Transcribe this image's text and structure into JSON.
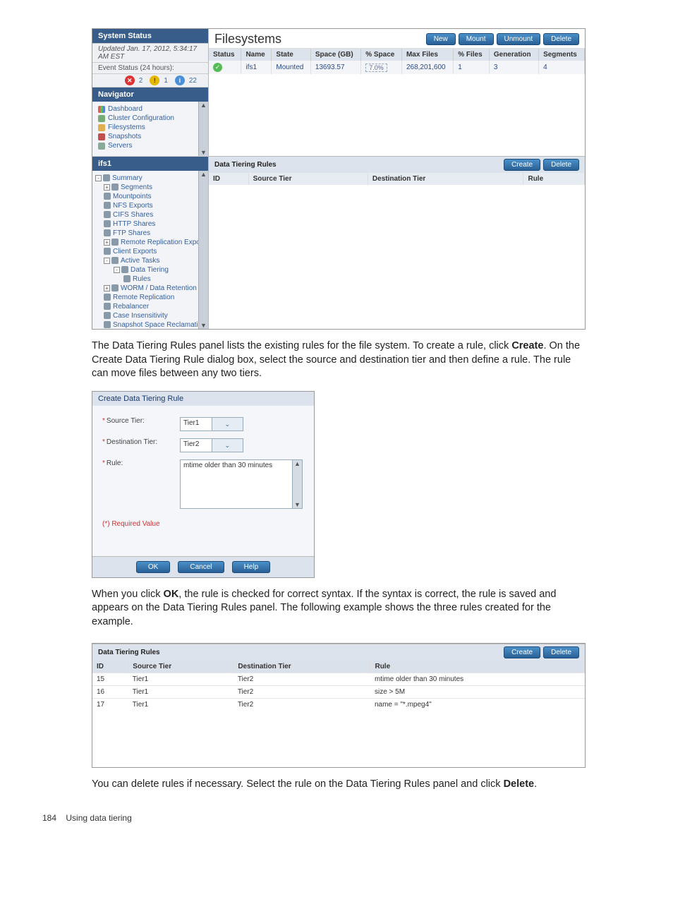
{
  "system_status": {
    "title": "System Status",
    "updated": "Updated Jan. 17, 2012, 5:34:17 AM EST",
    "event_label": "Event Status (24 hours):",
    "red": "2",
    "yellow": "1",
    "blue": "22"
  },
  "navigator": {
    "title": "Navigator",
    "items": [
      "Dashboard",
      "Cluster Configuration",
      "Filesystems",
      "Snapshots",
      "Servers"
    ]
  },
  "ifs": {
    "title": "ifs1",
    "tree": [
      {
        "lvl": 0,
        "label": "Summary",
        "exp": "-"
      },
      {
        "lvl": 1,
        "label": "Segments",
        "exp": "+"
      },
      {
        "lvl": 1,
        "label": "Mountpoints",
        "exp": ""
      },
      {
        "lvl": 1,
        "label": "NFS Exports",
        "exp": ""
      },
      {
        "lvl": 1,
        "label": "CIFS Shares",
        "exp": ""
      },
      {
        "lvl": 1,
        "label": "HTTP Shares",
        "exp": ""
      },
      {
        "lvl": 1,
        "label": "FTP Shares",
        "exp": ""
      },
      {
        "lvl": 1,
        "label": "Remote Replication Exports",
        "exp": "+"
      },
      {
        "lvl": 1,
        "label": "Client Exports",
        "exp": ""
      },
      {
        "lvl": 1,
        "label": "Active Tasks",
        "exp": "-"
      },
      {
        "lvl": 2,
        "label": "Data Tiering",
        "exp": "-"
      },
      {
        "lvl": 3,
        "label": "Rules",
        "exp": ""
      },
      {
        "lvl": 1,
        "label": "WORM / Data Retention",
        "exp": "+"
      },
      {
        "lvl": 1,
        "label": "Remote Replication",
        "exp": ""
      },
      {
        "lvl": 1,
        "label": "Rebalancer",
        "exp": ""
      },
      {
        "lvl": 1,
        "label": "Case Insensitivity",
        "exp": ""
      },
      {
        "lvl": 1,
        "label": "Snapshot Space Reclamation",
        "exp": ""
      }
    ]
  },
  "filesystems": {
    "title": "Filesystems",
    "buttons": {
      "new": "New",
      "mount": "Mount",
      "unmount": "Unmount",
      "delete": "Delete"
    },
    "headers": [
      "Status",
      "Name",
      "State",
      "Space (GB)",
      "% Space",
      "Max Files",
      "% Files",
      "Generation",
      "Segments"
    ],
    "row": {
      "name": "ifs1",
      "state": "Mounted",
      "space": "13693.57",
      "pct": "7.0%",
      "maxfiles": "268,201,600",
      "pctfiles": "1",
      "gen": "3",
      "seg": "4"
    }
  },
  "dtr1": {
    "title": "Data Tiering Rules",
    "create": "Create",
    "delete": "Delete",
    "headers": [
      "ID",
      "Source Tier",
      "Destination Tier",
      "Rule"
    ]
  },
  "para1_a": "The Data Tiering Rules panel lists the existing rules for the file system. To create a rule, click ",
  "para1_b": "Create",
  "para1_c": ". On the Create Data Tiering Rule dialog box, select the source and destination tier and then define a rule. The rule can move files between any two tiers.",
  "dialog": {
    "title": "Create Data Tiering Rule",
    "source_label": "Source Tier:",
    "source_value": "Tier1",
    "dest_label": "Destination Tier:",
    "dest_value": "Tier2",
    "rule_label": "Rule:",
    "rule_value": "mtime older than 30 minutes",
    "req_note": "(*) Required Value",
    "ok": "OK",
    "cancel": "Cancel",
    "help": "Help"
  },
  "para2_a": "When you click ",
  "para2_b": "OK",
  "para2_c": ", the rule is checked for correct syntax. If the syntax is correct, the rule is saved and appears on the Data Tiering Rules panel. The following example shows the three rules created for the example.",
  "rules_example": {
    "title": "Data Tiering Rules",
    "create": "Create",
    "delete": "Delete",
    "headers": [
      "ID",
      "Source Tier",
      "Destination Tier",
      "Rule"
    ],
    "rows": [
      {
        "id": "15",
        "src": "Tier1",
        "dst": "Tier2",
        "rule": "mtime older than 30 minutes"
      },
      {
        "id": "16",
        "src": "Tier1",
        "dst": "Tier2",
        "rule": "size > 5M"
      },
      {
        "id": "17",
        "src": "Tier1",
        "dst": "Tier2",
        "rule": "name = \"*.mpeg4\""
      }
    ]
  },
  "para3_a": "You can delete rules if necessary. Select the rule on the Data Tiering Rules panel and click ",
  "para3_b": "Delete",
  "para3_c": ".",
  "footer": {
    "page": "184",
    "section": "Using data tiering"
  }
}
